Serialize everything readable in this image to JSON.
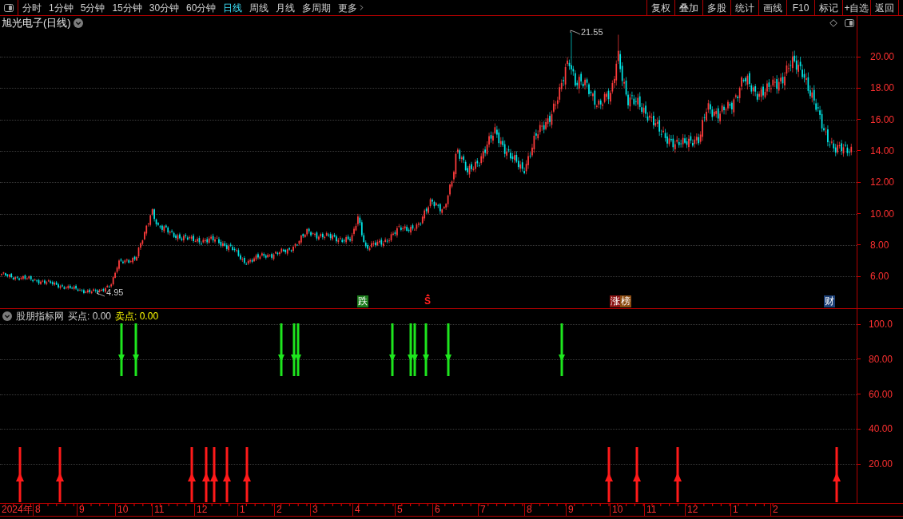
{
  "toolbar": {
    "periods": [
      {
        "label": "分时",
        "selected": false
      },
      {
        "label": "1分钟",
        "selected": false
      },
      {
        "label": "5分钟",
        "selected": false
      },
      {
        "label": "15分钟",
        "selected": false
      },
      {
        "label": "30分钟",
        "selected": false
      },
      {
        "label": "60分钟",
        "selected": false
      },
      {
        "label": "日线",
        "selected": true
      },
      {
        "label": "周线",
        "selected": false
      },
      {
        "label": "月线",
        "selected": false
      },
      {
        "label": "多周期",
        "selected": false
      }
    ],
    "more": {
      "label": "更多"
    },
    "actions": [
      "复权",
      "叠加",
      "多股",
      "统计",
      "画线",
      "F10",
      "标记",
      "+自选",
      "返回"
    ]
  },
  "main_chart": {
    "title": "旭光电子(日线)",
    "high_label": "21.55",
    "low_label": "4.95",
    "price_axis": [
      "20.00",
      "18.00",
      "16.00",
      "14.00",
      "12.00",
      "10.00",
      "8.00",
      "6.00"
    ],
    "events": [
      {
        "text": "跌",
        "kind": "tag",
        "color": "#1c7c1c"
      },
      {
        "text": "S",
        "kind": "sign",
        "color": "#ff2020"
      },
      {
        "text": "涨",
        "kind": "tag",
        "color": "#8c1414"
      },
      {
        "text": "榜",
        "kind": "tag",
        "color": "#8c4c12"
      },
      {
        "text": "财",
        "kind": "tag",
        "color": "#1c4078"
      }
    ]
  },
  "indicator": {
    "name": "股朋指标网",
    "readings": [
      {
        "text": "买点: 0.00",
        "color": "#d2d2d2"
      },
      {
        "text": "卖点: 0.00",
        "color": "#ffff00"
      }
    ],
    "axis": [
      "100.0",
      "80.00",
      "60.00",
      "40.00",
      "20.00"
    ]
  },
  "time_axis": [
    "2024年",
    "8",
    "9",
    "10",
    "11",
    "12",
    "1",
    "2",
    "3",
    "4",
    "5",
    "6",
    "7",
    "8",
    "9",
    "10",
    "11",
    "12",
    "1",
    "2"
  ]
}
